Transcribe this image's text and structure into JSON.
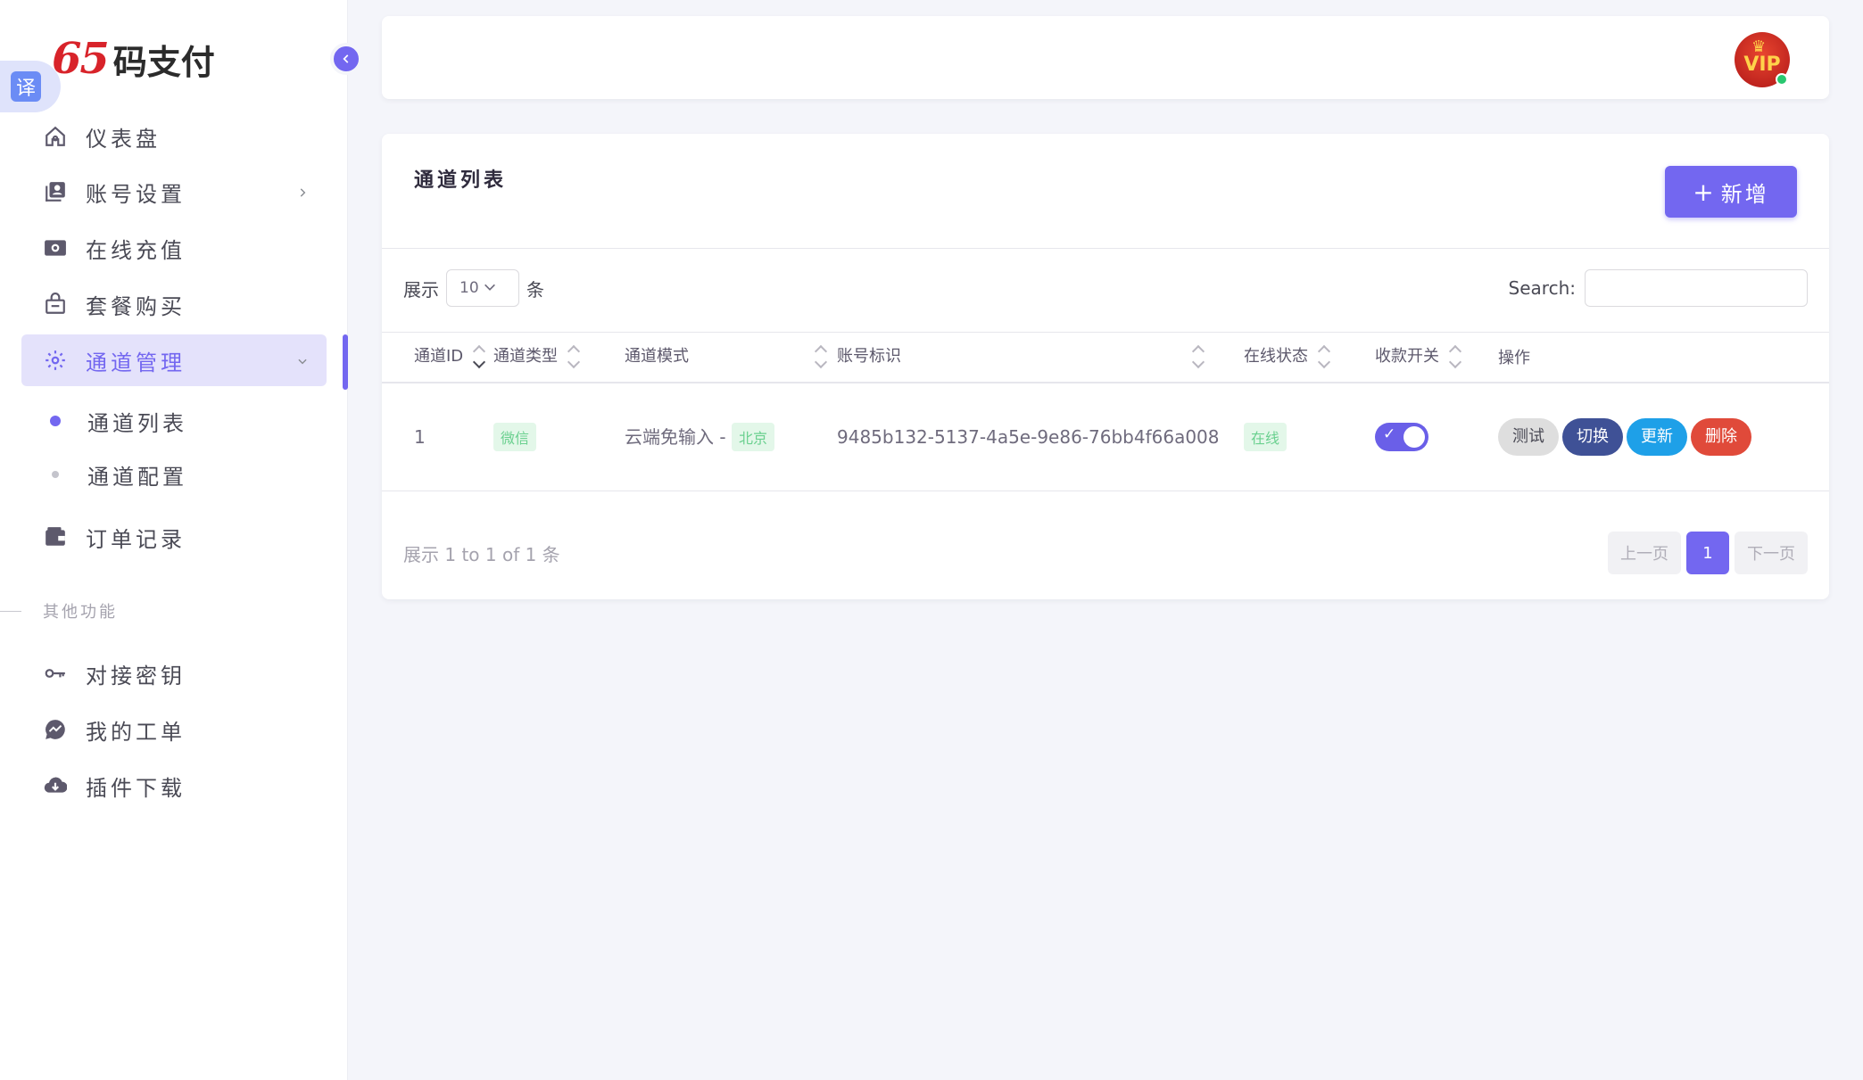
{
  "logo": {
    "number": "65",
    "text": "码支付"
  },
  "translate_badge": "译",
  "sidebar": {
    "items": [
      {
        "label": "仪表盘",
        "icon": "home-icon"
      },
      {
        "label": "账号设置",
        "icon": "account-icon"
      },
      {
        "label": "在线充值",
        "icon": "recharge-icon"
      },
      {
        "label": "套餐购买",
        "icon": "package-icon"
      },
      {
        "label": "通道管理",
        "icon": "gear-icon"
      },
      {
        "label": "订单记录",
        "icon": "wallet-icon"
      }
    ],
    "subitems": [
      {
        "label": "通道列表"
      },
      {
        "label": "通道配置"
      }
    ],
    "section_label": "其他功能",
    "other_items": [
      {
        "label": "对接密钥",
        "icon": "key-icon"
      },
      {
        "label": "我的工单",
        "icon": "message-icon"
      },
      {
        "label": "插件下载",
        "icon": "cloud-download-icon"
      }
    ]
  },
  "header": {
    "avatar_text": "VIP"
  },
  "card": {
    "title": "通道列表",
    "add_button": "新增",
    "add_plus": "+",
    "length": {
      "prefix": "展示",
      "value": "10",
      "suffix": "条"
    },
    "search": {
      "label": "Search:",
      "value": "",
      "placeholder": ""
    },
    "columns": [
      "通道ID",
      "通道类型",
      "通道模式",
      "账号标识",
      "在线状态",
      "收款开关",
      "操作"
    ],
    "rows": [
      {
        "id": "1",
        "type": "微信",
        "mode": "云端免输入 -",
        "region": "北京",
        "account": "9485b132-5137-4a5e-9e86-76bb4f66a008",
        "status": "在线",
        "switch_on": true,
        "actions": [
          "测试",
          "切换",
          "更新",
          "删除"
        ]
      }
    ],
    "info": "展示 1 to 1 of 1 条",
    "pagination": {
      "prev": "上一页",
      "current": "1",
      "next": "下一页"
    }
  },
  "colors": {
    "accent": "#7367f0",
    "success": "#28c76f",
    "danger": "#e04a3a",
    "info": "#1ea0e8"
  }
}
